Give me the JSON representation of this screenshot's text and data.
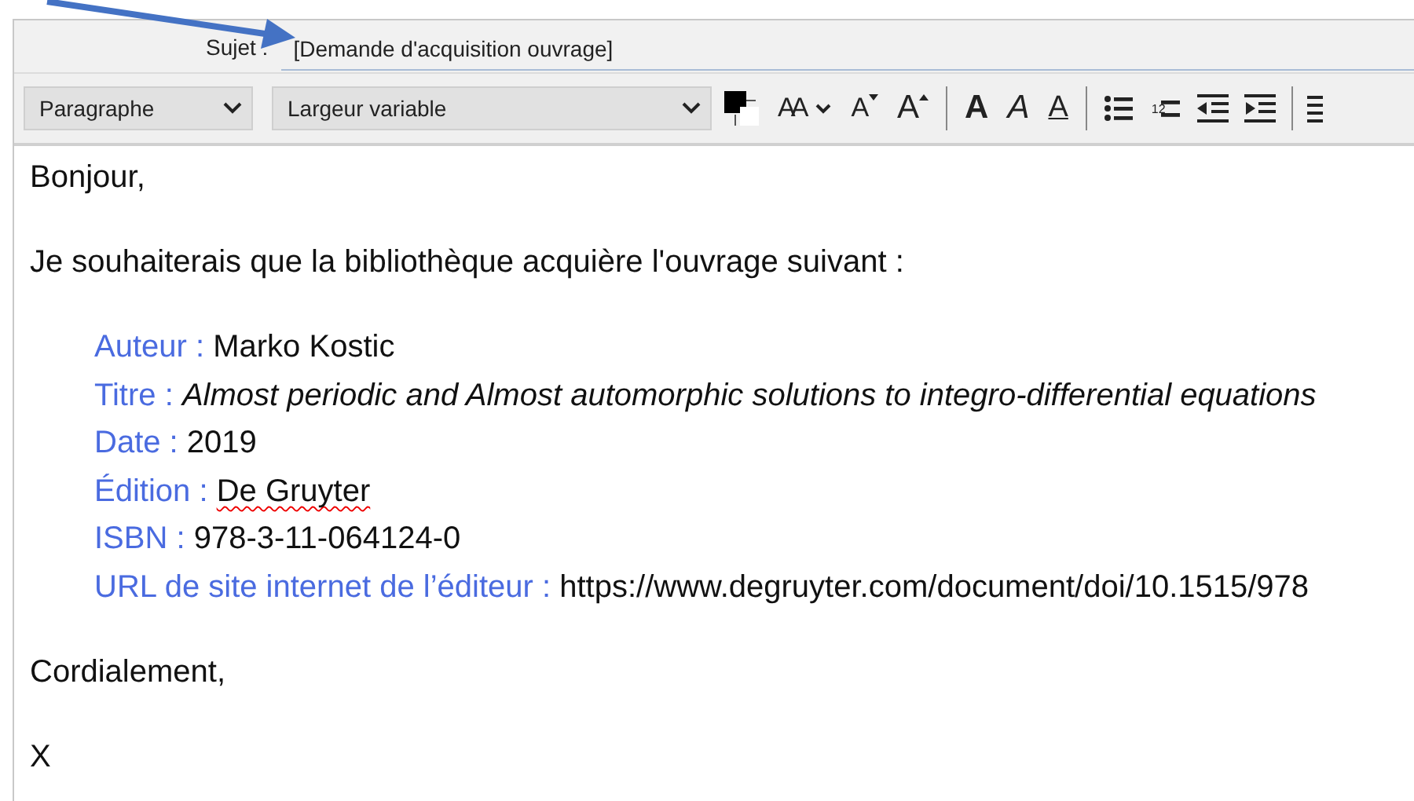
{
  "subject": {
    "label": "Sujet :",
    "value": "[Demande d'acquisition ouvrage]"
  },
  "toolbar": {
    "paragraph_select": "Paragraphe",
    "font_select": "Largeur variable",
    "buttons": [
      {
        "kind": "color"
      },
      {
        "kind": "size-menu",
        "glyph": "AA"
      },
      {
        "kind": "smaller",
        "glyph": "A"
      },
      {
        "kind": "larger",
        "glyph": "A"
      },
      {
        "kind": "separator"
      },
      {
        "kind": "bold",
        "glyph": "A"
      },
      {
        "kind": "italic",
        "glyph": "A"
      },
      {
        "kind": "underline",
        "glyph": "A"
      },
      {
        "kind": "separator"
      },
      {
        "kind": "bullets"
      },
      {
        "kind": "numbers",
        "glyph": "12"
      },
      {
        "kind": "outdent"
      },
      {
        "kind": "indent"
      },
      {
        "kind": "separator"
      },
      {
        "kind": "align"
      }
    ]
  },
  "body": {
    "greeting": "Bonjour,",
    "intro": "Je souhaiterais que la bibliothèque acquière l'ouvrage suivant :",
    "fields": [
      {
        "label": "Auteur :",
        "value": "Marko Kostic",
        "italic": false,
        "misspelled": false
      },
      {
        "label": "Titre :",
        "value": "Almost periodic and Almost automorphic solutions to integro-differential equations",
        "italic": true,
        "misspelled": false
      },
      {
        "label": "Date :",
        "value": "2019",
        "italic": false,
        "misspelled": false
      },
      {
        "label": "Édition :",
        "value": "De Gruyter",
        "italic": false,
        "misspelled": true
      },
      {
        "label": "ISBN :",
        "value": "978-3-11-064124-0",
        "italic": false,
        "misspelled": false
      },
      {
        "label": "URL de site internet de l’éditeur :",
        "value": "https://www.degruyter.com/document/doi/10.1515/978",
        "italic": false,
        "misspelled": false
      }
    ],
    "closing": "Cordialement,",
    "signature": "X"
  }
}
